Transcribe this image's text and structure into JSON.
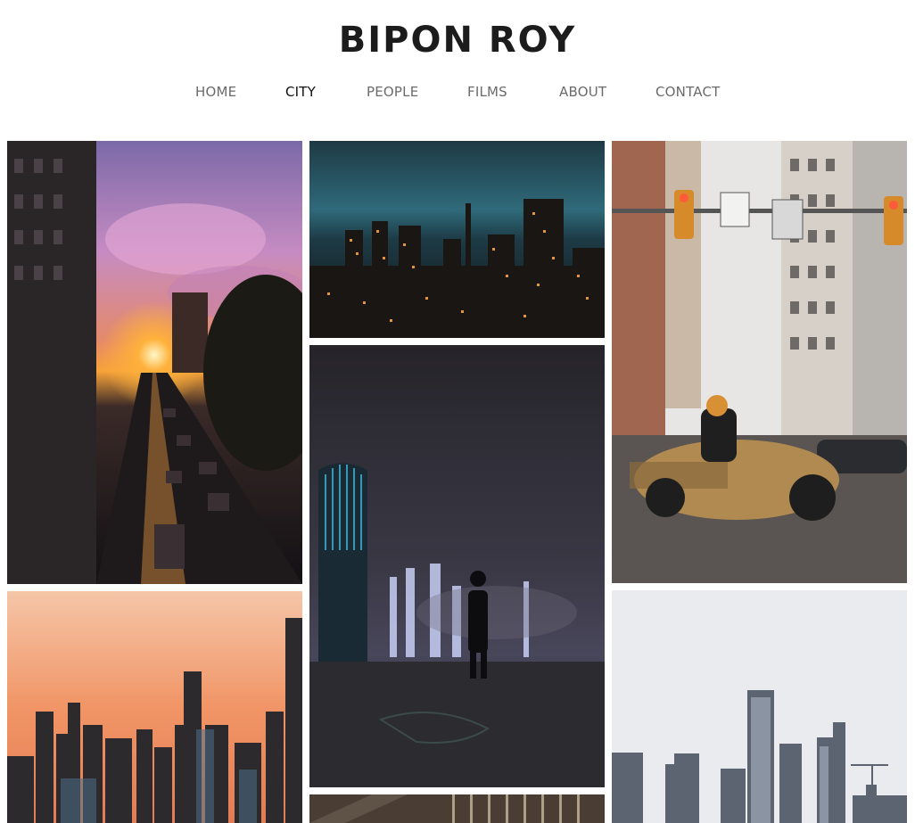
{
  "site": {
    "title": "BIPON ROY"
  },
  "nav": {
    "items": [
      {
        "label": "HOME"
      },
      {
        "label": "CITY"
      },
      {
        "label": "PEOPLE"
      },
      {
        "label": "FILMS"
      },
      {
        "label": "ABOUT"
      },
      {
        "label": "CONTACT"
      }
    ],
    "active_label": "CITY"
  },
  "gallery": {
    "photos": [
      {
        "subject": "sunset street with traffic"
      },
      {
        "subject": "night city skyline"
      },
      {
        "subject": "motorcycle at intersection"
      },
      {
        "subject": "man overlooking foggy night city"
      },
      {
        "subject": "sunset skyline"
      },
      {
        "subject": "overcast skyline"
      },
      {
        "subject": "building rooftop"
      }
    ]
  },
  "colors": {
    "title": "#1c1c1c",
    "nav_text": "#6b6b6b",
    "nav_active": "#111111",
    "background": "#ffffff"
  }
}
